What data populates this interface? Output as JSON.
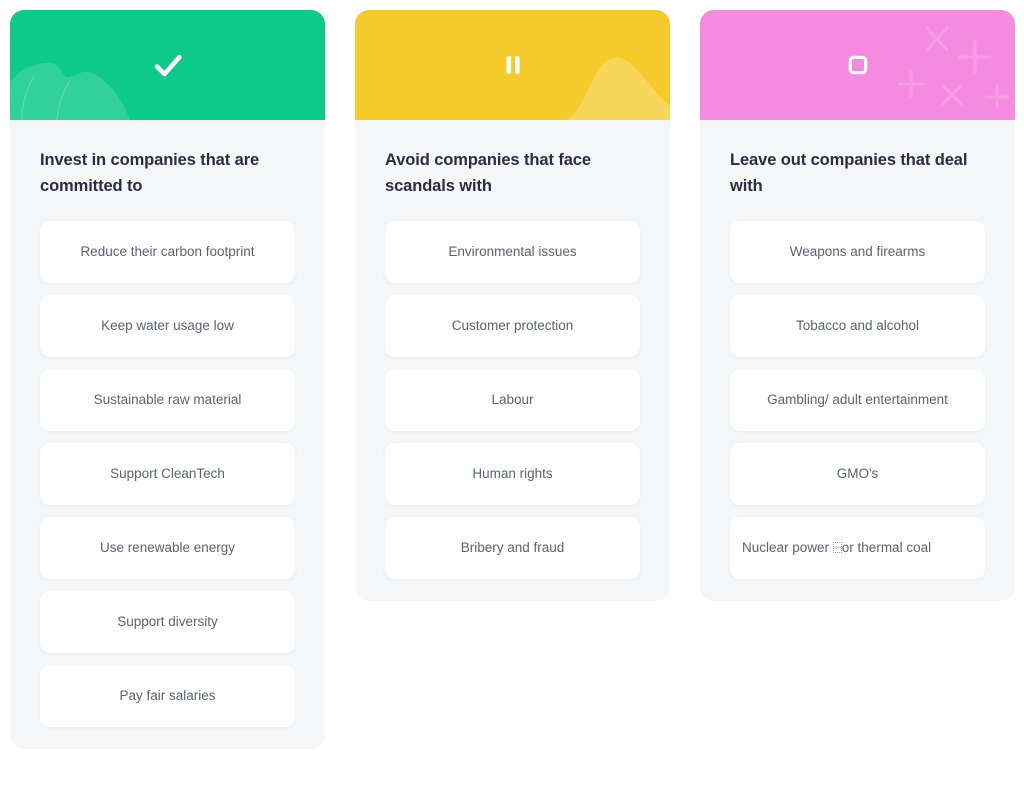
{
  "theme": {
    "page_background": "#ffffff",
    "card_background": "#f4f6f8",
    "pill_background": "#ffffff",
    "title_color": "#2b2d42",
    "label_color": "#5b6272"
  },
  "cards": [
    {
      "id": "invest",
      "header_color": "#0dc98a",
      "header_icon": "check-icon",
      "decoration": "leaf-shape",
      "title": "Invest in companies that are committed to",
      "items": [
        "Reduce their carbon footprint",
        "Keep water usage low",
        "Sustainable raw material",
        "Support CleanTech",
        "Use renewable energy",
        "Support diversity",
        "Pay fair salaries"
      ]
    },
    {
      "id": "avoid",
      "header_color": "#f5cb2b",
      "header_icon": "pause-icon",
      "decoration": "hill-shape",
      "title": "Avoid companies that face scandals with",
      "items": [
        "Environmental issues",
        "Customer protection",
        "Labour",
        "Human rights",
        "Bribery and fraud"
      ]
    },
    {
      "id": "leave-out",
      "header_color": "#f48be0",
      "header_icon": "stop-square-icon",
      "decoration": "sparkles",
      "title": "Leave out companies that deal with",
      "items": [
        "Weapons and firearms",
        "Tobacco and alcohol",
        "Gambling/ adult entertainment",
        "GMO's",
        "Nuclear power ␣or thermal coal"
      ],
      "items_detail": [
        {
          "text": "Weapons and firearms",
          "align": "center"
        },
        {
          "text": "Tobacco and alcohol",
          "align": "center"
        },
        {
          "text": "Gambling/ adult entertainment",
          "align": "center",
          "wide": true
        },
        {
          "text": "GMO's",
          "align": "center"
        },
        {
          "text_before": "Nuclear power ",
          "missing_glyph": "SEP",
          "text_after": "or thermal coal",
          "align": "left"
        }
      ]
    }
  ]
}
